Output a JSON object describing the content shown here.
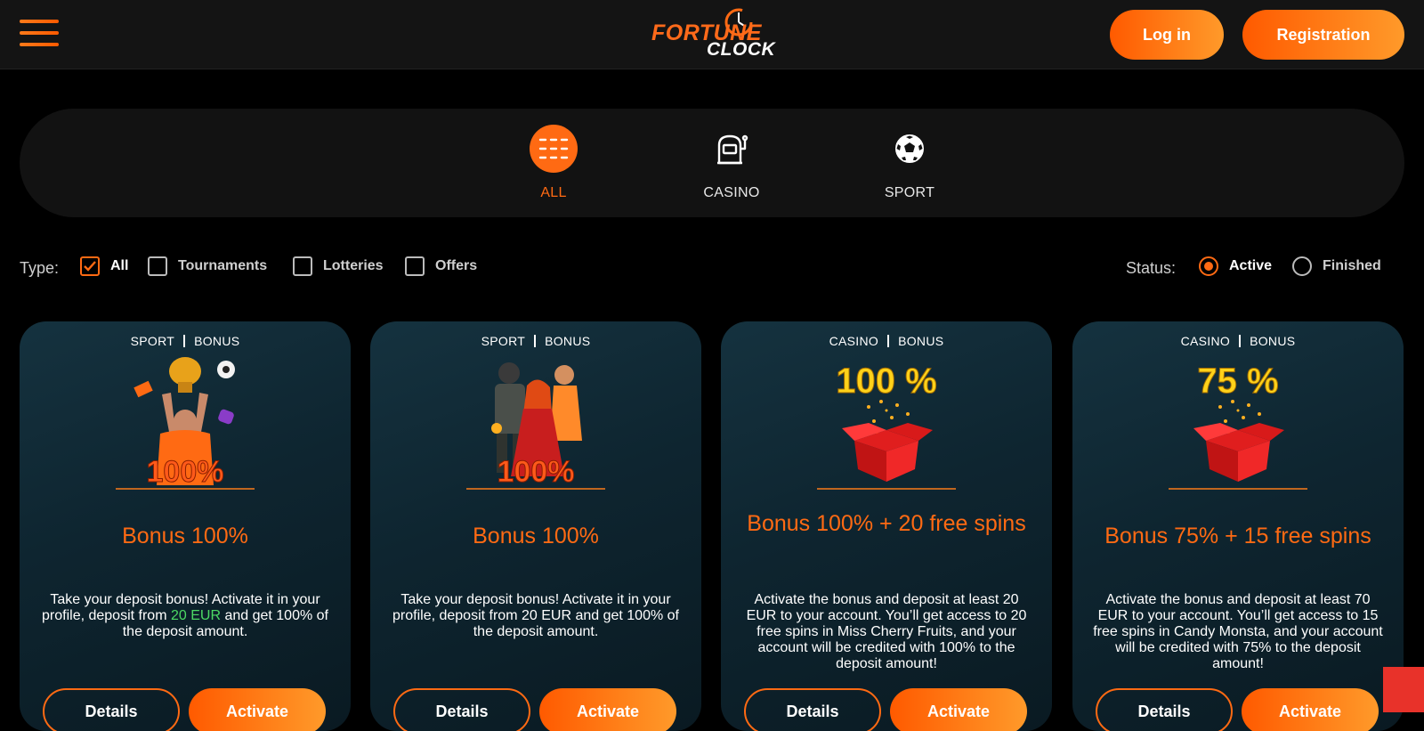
{
  "header": {
    "logo_line1": "FORTUNE",
    "logo_line2": "CLOCK",
    "login_label": "Log in",
    "register_label": "Registration"
  },
  "categories": [
    {
      "label": "ALL",
      "icon": "grid-icon",
      "active": true
    },
    {
      "label": "CASINO",
      "icon": "slot-machine-icon",
      "active": false
    },
    {
      "label": "SPORT",
      "icon": "soccer-ball-icon",
      "active": false
    }
  ],
  "filters": {
    "type_label": "Type:",
    "types": [
      {
        "label": "All",
        "checked": true
      },
      {
        "label": "Tournaments",
        "checked": false
      },
      {
        "label": "Lotteries",
        "checked": false
      },
      {
        "label": "Offers",
        "checked": false
      }
    ],
    "status_label": "Status:",
    "statuses": [
      {
        "label": "Active",
        "selected": true
      },
      {
        "label": "Finished",
        "selected": false
      }
    ]
  },
  "cards": [
    {
      "tag1": "SPORT",
      "tag2": "BONUS",
      "art_text": "100%",
      "title": "Bonus 100%",
      "desc_pre": "Take your deposit bonus! Activate it in your profile, deposit from ",
      "desc_hl": "20 EUR",
      "desc_post": " and get 100% of the deposit amount.",
      "details_label": "Details",
      "activate_label": "Activate"
    },
    {
      "tag1": "SPORT",
      "tag2": "BONUS",
      "art_text": "100%",
      "title": "Bonus 100%",
      "desc_pre": "Take your deposit bonus! Activate it in your profile, deposit from 20 EUR and get 100% of the deposit amount.",
      "desc_hl": "",
      "desc_post": "",
      "details_label": "Details",
      "activate_label": "Activate"
    },
    {
      "tag1": "CASINO",
      "tag2": "BONUS",
      "art_text": "100 %",
      "title": "Bonus 100% + 20 free spins",
      "desc_pre": "Activate the bonus and deposit at least 20 EUR to your account. You’ll get access to 20 free spins in Miss Cherry Fruits, and your account will be credited with 100% to the deposit amount!",
      "desc_hl": "",
      "desc_post": "",
      "details_label": "Details",
      "activate_label": "Activate"
    },
    {
      "tag1": "CASINO",
      "tag2": "BONUS",
      "art_text": "75 %",
      "title": "Bonus 75% + 15 free spins",
      "desc_pre": "Activate the bonus and deposit at least 70 EUR to your account. You’ll get access to 15 free spins in Candy Monsta, and your account will be credited with 75% to the deposit amount!",
      "desc_hl": "",
      "desc_post": "",
      "details_label": "Details",
      "activate_label": "Activate"
    }
  ],
  "colors": {
    "accent": "#ff6a13",
    "highlight": "#4cd964",
    "card_bg": "#0e2530"
  }
}
